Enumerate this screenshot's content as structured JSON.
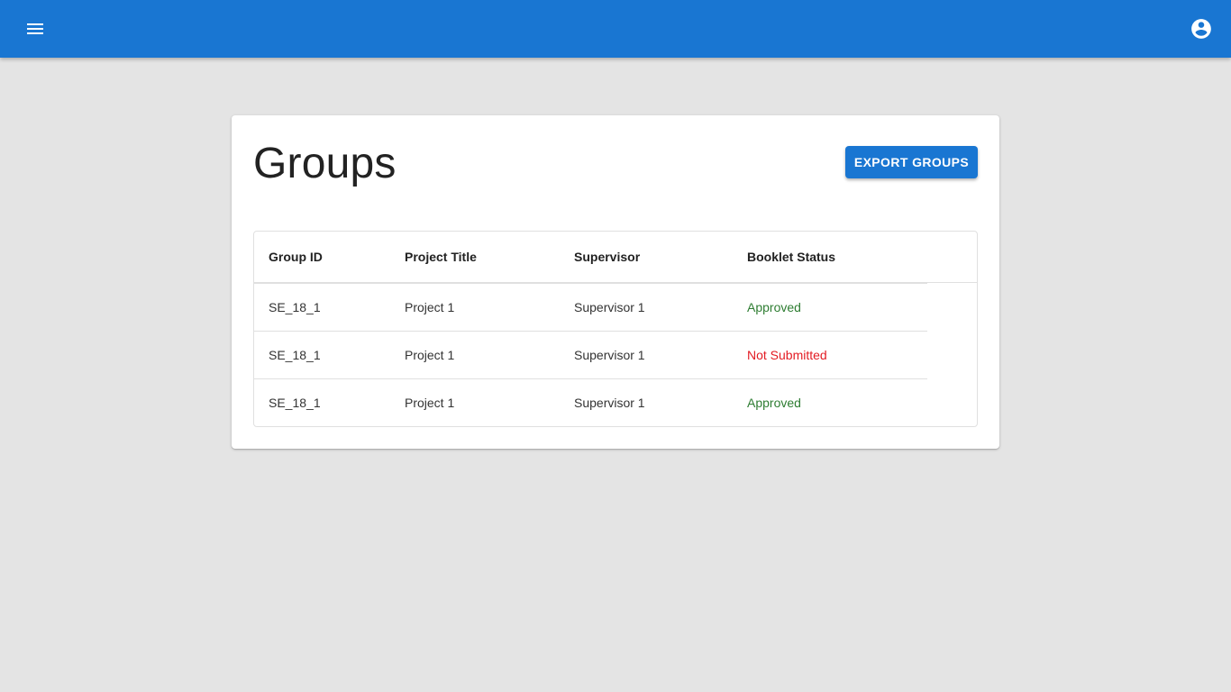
{
  "colors": {
    "appbar": "#1976d2",
    "approved": "#2e7d32",
    "not_submitted": "#e31b23"
  },
  "appbar": {
    "menu_icon": "menu-icon",
    "account_icon": "account-circle-icon"
  },
  "page": {
    "title": "Groups",
    "export_label": "EXPORT GROUPS"
  },
  "table": {
    "headers": [
      "Group ID",
      "Project Title",
      "Supervisor",
      "Booklet Status"
    ],
    "rows": [
      {
        "group_id": "SE_18_1",
        "project": "Project 1",
        "supervisor": "Supervisor 1",
        "status": "Approved",
        "status_color": "#2e7d32"
      },
      {
        "group_id": "SE_18_1",
        "project": "Project 1",
        "supervisor": "Supervisor 1",
        "status": "Not Submitted",
        "status_color": "#e31b23"
      },
      {
        "group_id": "SE_18_1",
        "project": "Project 1",
        "supervisor": "Supervisor 1",
        "status": "Approved",
        "status_color": "#2e7d32"
      }
    ]
  }
}
